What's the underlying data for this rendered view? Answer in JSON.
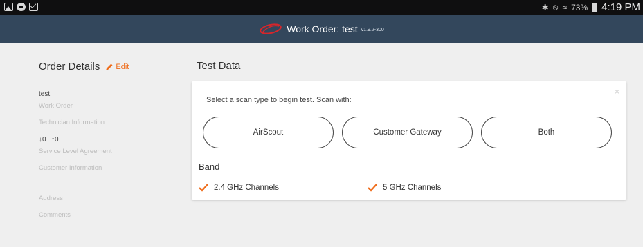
{
  "status_bar": {
    "left_icons": [
      "image-icon",
      "minus-circle-icon",
      "mail-icon"
    ],
    "signal_text": "✱ ⦸ ὏6",
    "battery_text": "73%",
    "time": "4:19 PM"
  },
  "header": {
    "logo": "swoosh-logo",
    "title": "Work Order: test",
    "version": "v1.9.2-300",
    "background_color": "#33475c"
  },
  "order_details": {
    "heading": "Order Details",
    "edit_label": "Edit",
    "accent_color": "#ef6c1a",
    "work_order_value": "test",
    "work_order_label": "Work Order",
    "technician_label": "Technician Information",
    "sla_down": "↓0",
    "sla_up": "↑0",
    "sla_label": "Service Level Agreement",
    "customer_label": "Customer Information",
    "address_label": "Address",
    "comments_label": "Comments"
  },
  "test_data": {
    "heading": "Test Data",
    "close_label": "×",
    "prompt": "Select a scan type to begin test. Scan with:",
    "scan_buttons": [
      "AirScout",
      "Customer Gateway",
      "Both"
    ],
    "band_label": "Band",
    "bands": [
      {
        "label": "2.4 GHz Channels",
        "checked": true
      },
      {
        "label": "5 GHz Channels",
        "checked": true
      }
    ]
  }
}
